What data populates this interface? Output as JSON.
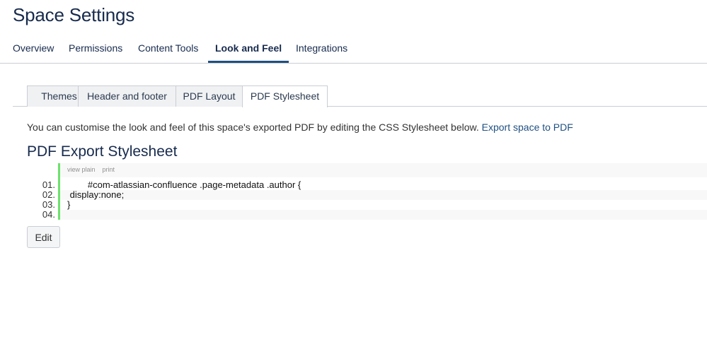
{
  "page": {
    "title": "Space Settings"
  },
  "top_nav": {
    "items": [
      {
        "label": "Overview"
      },
      {
        "label": "Permissions"
      },
      {
        "label": "Content Tools"
      },
      {
        "label": "Look and Feel",
        "active": true
      },
      {
        "label": "Integrations"
      }
    ]
  },
  "sub_tabs": {
    "items": [
      {
        "label": "Themes"
      },
      {
        "label": "Header and footer"
      },
      {
        "label": "PDF Layout"
      },
      {
        "label": "PDF Stylesheet",
        "active": true
      }
    ]
  },
  "intro": {
    "text": "You can customise the look and feel of this space's exported PDF by editing the CSS Stylesheet below.",
    "link": "Export space to PDF"
  },
  "section": {
    "title": "PDF Export Stylesheet"
  },
  "code": {
    "toolbar": {
      "view_plain": "view plain",
      "print": "print"
    },
    "lines": [
      {
        "number": "01.",
        "text": "        #com-atlassian-confluence .page-metadata .author {"
      },
      {
        "number": "02.",
        "text": " display:none;"
      },
      {
        "number": "03.",
        "text": "}"
      },
      {
        "number": "04.",
        "text": ""
      }
    ]
  },
  "actions": {
    "edit_label": "Edit"
  },
  "colors": {
    "accent": "#205081",
    "gutter_bar": "#6ce26c",
    "border": "#c9cdd3",
    "tab_bg": "#f0f1f3"
  }
}
